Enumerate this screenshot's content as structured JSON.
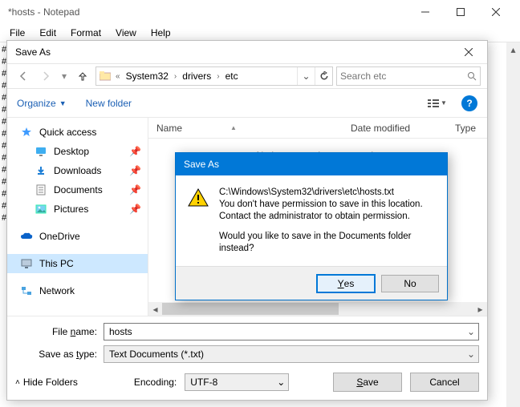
{
  "notepad": {
    "title": "*hosts - Notepad",
    "menu": [
      "File",
      "Edit",
      "Format",
      "View",
      "Help"
    ],
    "gutter_char": "#"
  },
  "saveas": {
    "title": "Save As",
    "breadcrumb": {
      "ellipsis": "«",
      "segments": [
        "System32",
        "drivers",
        "etc"
      ]
    },
    "search": {
      "placeholder": "Search etc"
    },
    "toolbar": {
      "organize": "Organize",
      "newfolder": "New folder"
    },
    "tree": {
      "quick": "Quick access",
      "items": [
        {
          "label": "Desktop",
          "icon": "desktop"
        },
        {
          "label": "Downloads",
          "icon": "downloads"
        },
        {
          "label": "Documents",
          "icon": "documents"
        },
        {
          "label": "Pictures",
          "icon": "pictures"
        }
      ],
      "onedrive": "OneDrive",
      "thispc": "This PC",
      "network": "Network"
    },
    "columns": {
      "name": "Name",
      "date": "Date modified",
      "type": "Type"
    },
    "empty_msg": "No items match your search.",
    "filename_label": "File name:",
    "filename_value": "hosts",
    "saveastype_label": "Save as type:",
    "saveastype_value": "Text Documents (*.txt)",
    "hide_folders": "Hide Folders",
    "encoding_label": "Encoding:",
    "encoding_value": "UTF-8",
    "save_btn": "Save",
    "cancel_btn": "Cancel"
  },
  "alert": {
    "title": "Save As",
    "path": "C:\\Windows\\System32\\drivers\\etc\\hosts.txt",
    "line1": "You don't have permission to save in this location.",
    "line2": "Contact the administrator to obtain permission.",
    "line3": "Would you like to save in the Documents folder instead?",
    "yes": "Yes",
    "no": "No"
  }
}
